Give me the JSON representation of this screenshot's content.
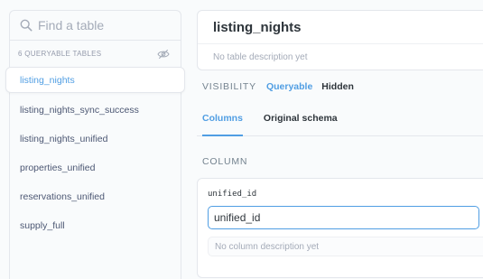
{
  "sidebar": {
    "search_placeholder": "Find a table",
    "tables_count_label": "6 QUERYABLE TABLES",
    "tables": [
      {
        "label": "listing_nights",
        "active": true
      },
      {
        "label": "listing_nights_sync_success"
      },
      {
        "label": "listing_nights_unified"
      },
      {
        "label": "properties_unified"
      },
      {
        "label": "reservations_unified"
      },
      {
        "label": "supply_full"
      }
    ]
  },
  "table": {
    "name": "listing_nights",
    "description_placeholder": "No table description yet"
  },
  "visibility": {
    "label": "VISIBILITY",
    "options": [
      "Queryable",
      "Hidden"
    ],
    "selected": "Queryable"
  },
  "tabs": [
    "Columns",
    "Original schema"
  ],
  "active_tab": "Columns",
  "columns_header": "COLUMN",
  "column": {
    "field_name": "unified_id",
    "display_name": "unified_id",
    "description_placeholder": "No column description yet"
  },
  "colors": {
    "accent": "#509ee3",
    "text_dark": "#2e353b",
    "text_muted": "#a4abb8",
    "border": "#e4e7ec"
  }
}
